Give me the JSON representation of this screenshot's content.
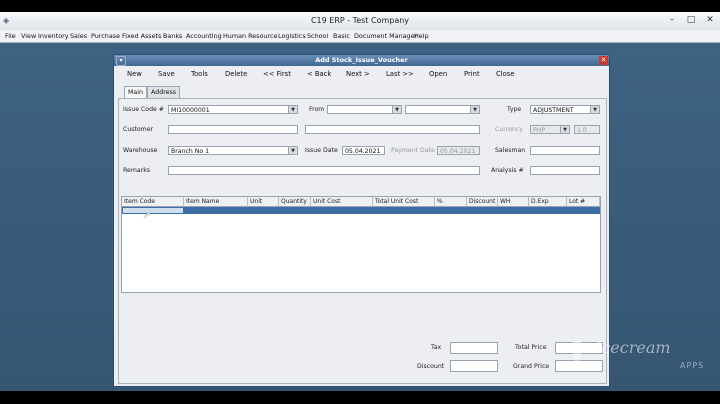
{
  "window": {
    "title": "C19 ERP - Test Company",
    "min": "–",
    "max": "□",
    "close": "✕"
  },
  "menu": [
    "File",
    "View",
    "Inventory",
    "Sales",
    "Purchase",
    "Fixed Assets",
    "Banks",
    "Accounting",
    "Human Resource",
    "Logistics",
    "School",
    "Basic",
    "Document Manager",
    "Help"
  ],
  "dialog": {
    "title": "Add Stock_Issue_Voucher",
    "toolbar": {
      "new": "New",
      "save": "Save",
      "tools": "Tools",
      "delete": "Delete",
      "first": "<< First",
      "back": "< Back",
      "next": "Next >",
      "last": "Last >>",
      "open": "Open",
      "print": "Print",
      "close": "Close"
    },
    "tabs": {
      "main": "Main",
      "address": "Address"
    },
    "form": {
      "issue_code_label": "Issue Code #",
      "issue_code": "MI10000001",
      "from_label": "From",
      "from_value": "",
      "from_value2": "",
      "type_label": "Type",
      "type_value": "ADJUSTMENT",
      "customer_label": "Customer",
      "customer": "",
      "customer_name": "",
      "currency_label": "Currency",
      "currency": "PHP",
      "rate": "1.0",
      "warehouse_label": "Warehouse",
      "warehouse": "Branch No 1",
      "issue_date_label": "Issue Date",
      "issue_date": "05.04.2021",
      "payment_date_label": "Payment Date",
      "payment_date": "05.04.2021",
      "salesman_label": "Salesman",
      "salesman": "",
      "remarks_label": "Remarks",
      "remarks": "",
      "analysis_label": "Analysis #",
      "analysis": ""
    },
    "grid": {
      "columns": [
        "Item Code",
        "Item Name",
        "Unit",
        "Quantity",
        "Unit Cost",
        "Total Unit Cost",
        "%",
        "Discount",
        "WH",
        "D.Exp",
        "Lot #"
      ]
    },
    "totals": {
      "tax_label": "Tax",
      "total_price_label": "Total Price",
      "discount_label": "Discount",
      "grand_price_label": "Grand Price"
    }
  },
  "watermark": {
    "brand": "Icecream",
    "sub": "APPS"
  }
}
